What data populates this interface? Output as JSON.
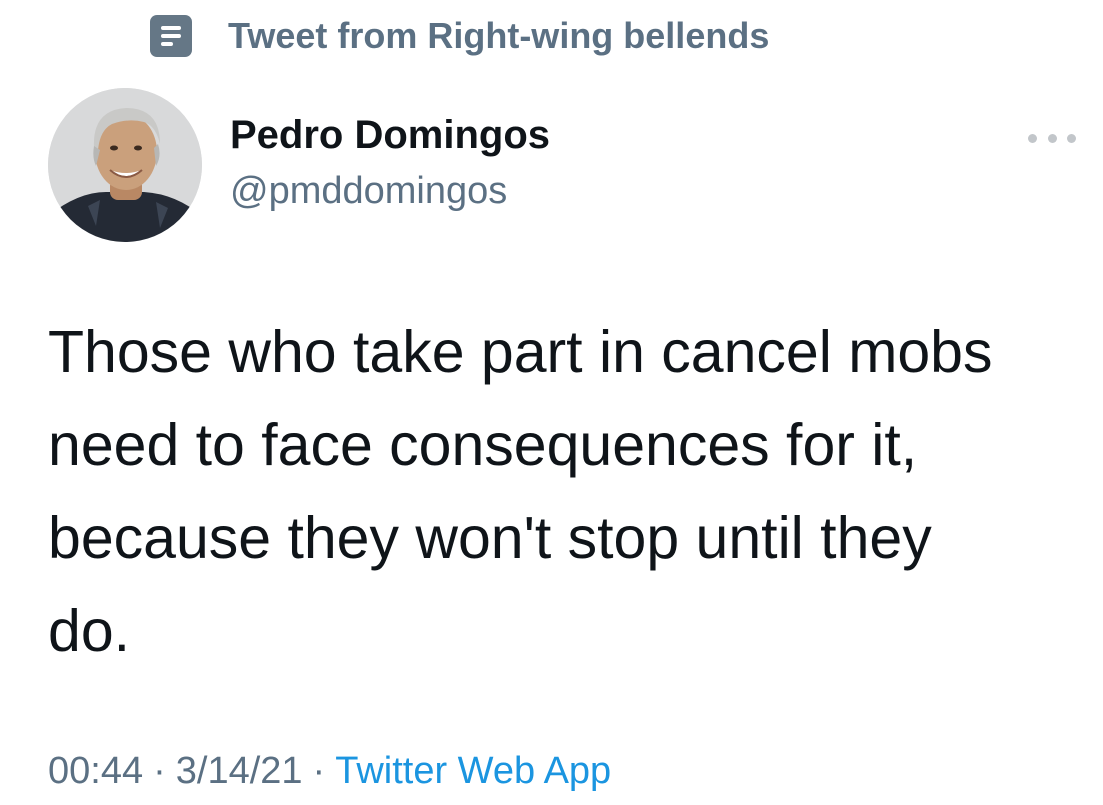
{
  "context": {
    "icon": "list-icon",
    "text": "Tweet from Right-wing bellends"
  },
  "author": {
    "avatar_icon": "profile-photo",
    "display_name": "Pedro Domingos",
    "handle": "@pmddomingos"
  },
  "more_icon": "more-horizontal-icon",
  "tweet": {
    "lines": [
      "Those who take part in cancel mobs",
      "need to face consequences for it,",
      "because they won't stop until they",
      "do."
    ]
  },
  "meta": {
    "time": "00:44",
    "separator": "·",
    "date": "3/14/21",
    "source": "Twitter Web App"
  },
  "colors": {
    "text_primary": "#0f1419",
    "text_secondary": "#5b7083",
    "link": "#1b95e0"
  }
}
